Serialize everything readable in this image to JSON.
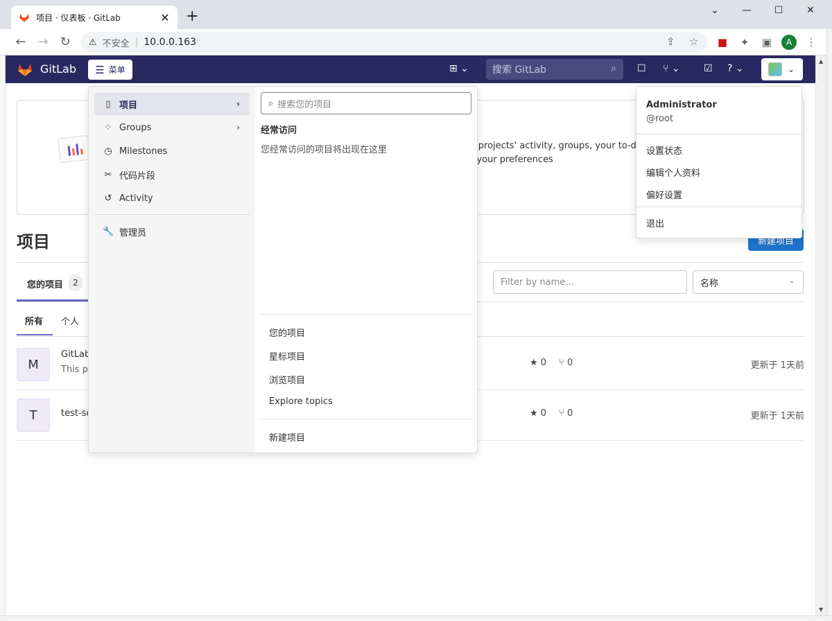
{
  "browser": {
    "tab_title": "项目 · 仪表板 · GitLab",
    "tab_close": "✕",
    "new_tab": "+",
    "window_minimize": "—",
    "window_maximize": "☐",
    "window_close": "✕",
    "back": "←",
    "forward": "→",
    "reload": "↻",
    "security_warning": "⚠",
    "security_text": "不安全",
    "url": "10.0.0.163",
    "profile_initial": "A"
  },
  "header": {
    "brand": "GitLab",
    "menu_label": "菜单",
    "search_placeholder": "搜索 GitLab"
  },
  "menu": {
    "items": [
      {
        "label": "项目",
        "icon": "project-icon"
      },
      {
        "label": "Groups",
        "icon": "group-icon"
      },
      {
        "label": "Milestones",
        "icon": "clock-icon"
      },
      {
        "label": "代码片段",
        "icon": "scissors-icon"
      },
      {
        "label": "Activity",
        "icon": "history-icon"
      },
      {
        "label": "管理员",
        "icon": "wrench-icon"
      }
    ],
    "search_placeholder": "搜索您的项目",
    "frequent_title": "经常访问",
    "frequent_empty": "您经常访问的项目将出现在这里",
    "links": [
      "您的项目",
      "星标项目",
      "浏览项目",
      "Explore topics"
    ],
    "new_project": "新建项目"
  },
  "user_menu": {
    "name": "Administrator",
    "handle": "@root",
    "links": [
      "设置状态",
      "编辑个人资料",
      "偏好设置"
    ],
    "sign_out": "退出"
  },
  "page": {
    "callout_line1": "w projects' activity, groups, your to-d",
    "callout_line2": "n your preferences",
    "title": "项目",
    "new_project_button": "新建项目",
    "tab_yours": "您的项目",
    "tab_yours_count": "2",
    "filter_placeholder": "Filter by name...",
    "sort_value": "名称",
    "subtabs": [
      "所有",
      "个人"
    ]
  },
  "projects": [
    {
      "avatar": "M",
      "name": "GitLab",
      "desc": "This pr",
      "stars": "0",
      "forks": "0",
      "updated": "更新于 1天前"
    },
    {
      "avatar": "T",
      "name": "test-se",
      "desc": "",
      "stars": "0",
      "forks": "0",
      "updated": "更新于 1天前"
    }
  ],
  "colors": {
    "header_bg": "#292961",
    "accent": "#1f75cb",
    "tab_indicator": "#6666c4"
  }
}
